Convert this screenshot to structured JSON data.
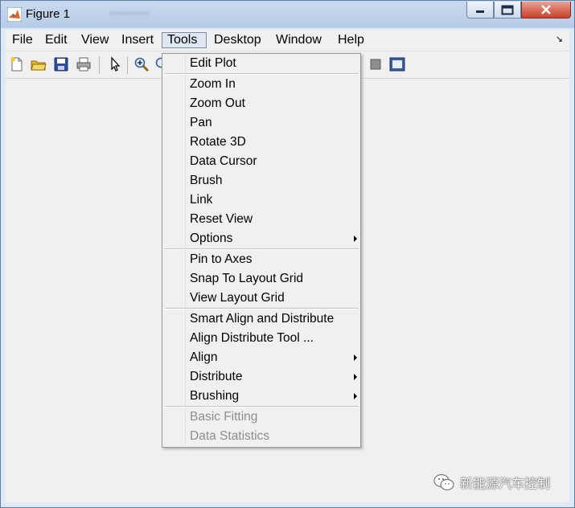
{
  "window": {
    "title": "Figure 1",
    "blurred_text": "•••••••••••"
  },
  "menubar": {
    "items": [
      "File",
      "Edit",
      "View",
      "Insert",
      "Tools",
      "Desktop",
      "Window",
      "Help"
    ],
    "active": "Tools",
    "dock_glyph": "↘"
  },
  "toolbar": {
    "icons": [
      "new-figure-icon",
      "open-file-icon",
      "save-icon",
      "print-icon",
      "edit-plot-arrow-icon",
      "zoom-in-icon",
      "zoom-out-icon",
      "hide-plot-tools-icon",
      "show-plot-tools-icon"
    ]
  },
  "tools_menu": {
    "items": [
      {
        "label": "Edit Plot"
      },
      {
        "label": "Zoom In"
      },
      {
        "label": "Zoom Out"
      },
      {
        "label": "Pan"
      },
      {
        "label": "Rotate 3D"
      },
      {
        "label": "Data Cursor"
      },
      {
        "label": "Brush"
      },
      {
        "label": "Link"
      },
      {
        "label": "Reset View"
      },
      {
        "label": "Options",
        "submenu": true
      },
      {
        "label": "Pin to Axes"
      },
      {
        "label": "Snap To Layout Grid"
      },
      {
        "label": "View Layout Grid"
      },
      {
        "label": "Smart Align and Distribute"
      },
      {
        "label": "Align Distribute Tool ..."
      },
      {
        "label": "Align",
        "submenu": true
      },
      {
        "label": "Distribute",
        "submenu": true
      },
      {
        "label": "Brushing",
        "submenu": true
      },
      {
        "label": "Basic Fitting",
        "disabled": true
      },
      {
        "label": "Data Statistics",
        "disabled": true
      }
    ]
  },
  "watermark": {
    "text": "新能源汽车控制",
    "icon": "wechat-icon"
  },
  "colors": {
    "titlebar": "#c9daee",
    "menu_bg": "#f0f0f0",
    "disabled_text": "#8d8d8d",
    "close_button": "#c9412c"
  }
}
